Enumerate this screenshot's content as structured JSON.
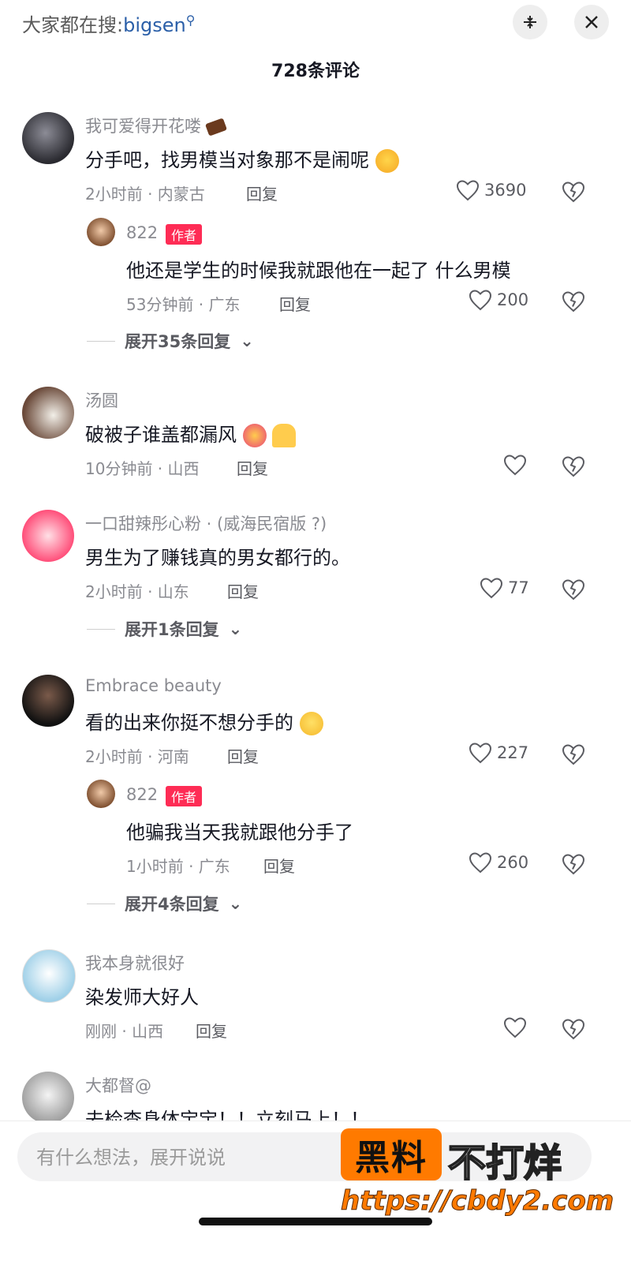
{
  "header": {
    "search_prefix": "大家都在搜:",
    "search_keyword": "bigsen",
    "comment_count": "728条评论"
  },
  "comments": [
    {
      "user": "我可爱得开花喽",
      "text": "分手吧，找男模当对象那不是闹呢",
      "meta": "2小时前 · 内蒙古",
      "reply_label": "回复",
      "likes": "3690",
      "replies": [
        {
          "user": "822",
          "badge": "作者",
          "text": "他还是学生的时候我就跟他在一起了 什么男模",
          "meta": "53分钟前 · 广东",
          "reply_label": "回复",
          "likes": "200"
        }
      ],
      "expand": "展开35条回复"
    },
    {
      "user": "汤圆",
      "text": "破被子谁盖都漏风",
      "meta": "10分钟前 · 山西",
      "reply_label": "回复",
      "likes": ""
    },
    {
      "user": "一口甜辣彤心粉 · (威海民宿版 ?)",
      "text": "男生为了赚钱真的男女都行的。",
      "meta": "2小时前 · 山东",
      "reply_label": "回复",
      "likes": "77",
      "expand": "展开1条回复"
    },
    {
      "user": "Embrace beauty",
      "text": "看的出来你挺不想分手的",
      "meta": "2小时前 · 河南",
      "reply_label": "回复",
      "likes": "227",
      "replies": [
        {
          "user": "822",
          "badge": "作者",
          "text": "他骗我当天我就跟他分手了",
          "meta": "1小时前 · 广东",
          "reply_label": "回复",
          "likes": "260"
        }
      ],
      "expand": "展开4条回复"
    },
    {
      "user": "我本身就很好",
      "text": "染发师大好人",
      "meta": "刚刚 · 山西",
      "reply_label": "回复",
      "likes": ""
    },
    {
      "user": "大都督@",
      "text": "去检查身体宝宝！！立刻马上！！"
    }
  ],
  "input": {
    "placeholder": "有什么想法，展开说说"
  },
  "watermark": {
    "badge": "黑料",
    "text": "不打烊",
    "url": "https://cbdy2.com"
  },
  "colors": {
    "accent": "#fe2c55",
    "keyword": "#2b5fa8",
    "watermark": "#ff7a00"
  }
}
